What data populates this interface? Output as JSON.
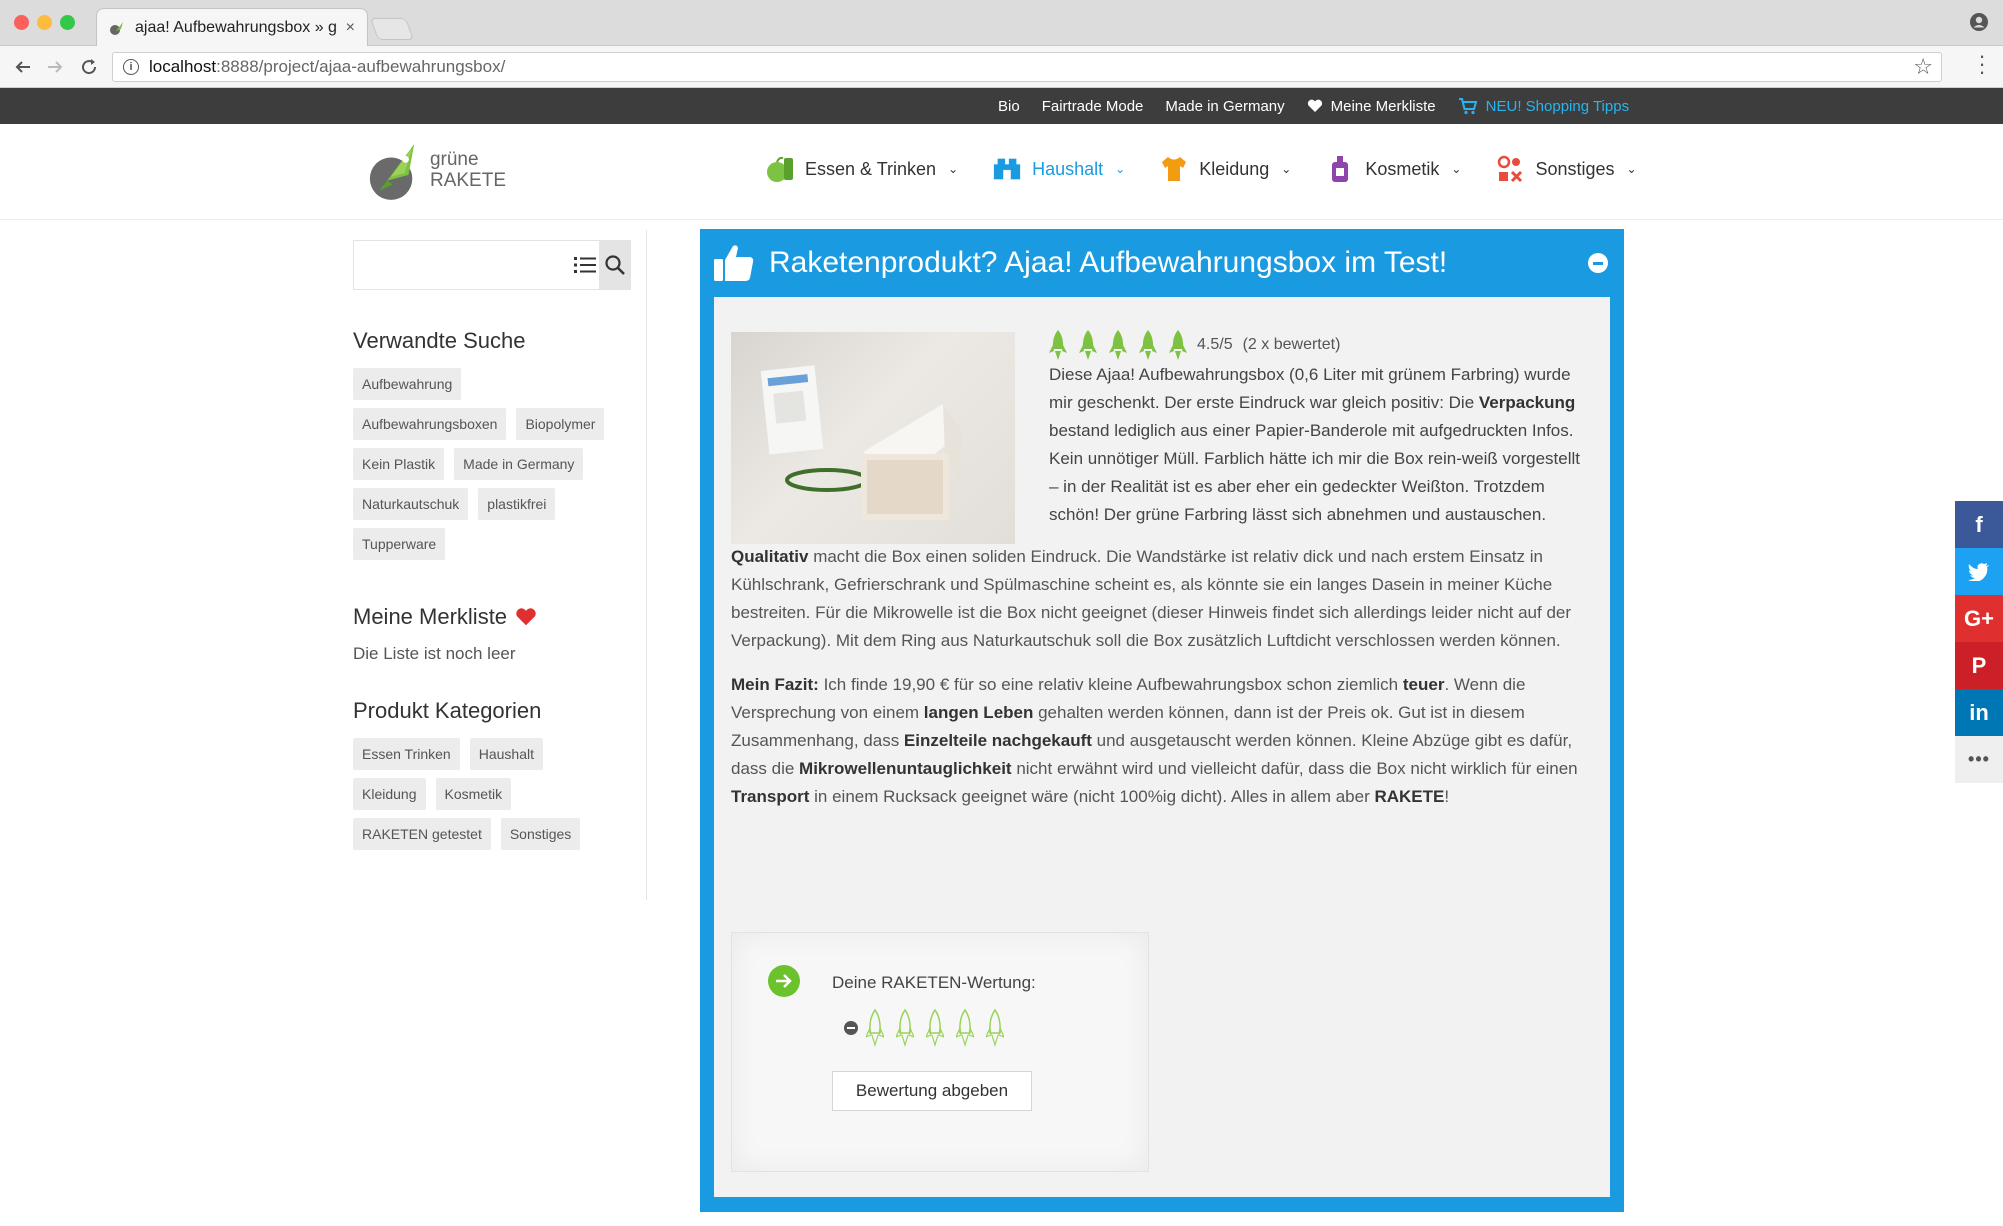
{
  "browser": {
    "tab_title": "ajaa! Aufbewahrungsbox » grü",
    "tab_close": "×",
    "url_host": "localhost",
    "url_rest": ":8888/project/ajaa-aufbewahrungsbox/"
  },
  "topbar": {
    "links": [
      "Bio",
      "Fairtrade Mode",
      "Made in Germany"
    ],
    "wishlist": "Meine Merkliste",
    "shopping": "NEU! Shopping Tipps",
    "accent_color": "#28b4f0"
  },
  "logo": {
    "line1": "grüne",
    "line2": "RAKETE"
  },
  "nav": {
    "items": [
      {
        "label": "Essen & Trinken",
        "icon": "apple-icon"
      },
      {
        "label": "Haushalt",
        "icon": "house-icon"
      },
      {
        "label": "Kleidung",
        "icon": "shirt-icon"
      },
      {
        "label": "Kosmetik",
        "icon": "bottle-icon"
      },
      {
        "label": "Sonstiges",
        "icon": "shapes-icon"
      }
    ],
    "caret": "⌄",
    "active_color": "#1a9ae0"
  },
  "sidebar": {
    "related_heading": "Verwandte Suche",
    "related_tags": [
      "Aufbewahrung",
      "Aufbewahrungsboxen",
      "Biopolymer",
      "Kein Plastik",
      "Made in Germany",
      "Naturkautschuk",
      "plastikfrei",
      "Tupperware"
    ],
    "wishlist_heading": "Meine Merkliste",
    "wishlist_empty": "Die Liste ist noch leer",
    "categories_heading": "Produkt Kategorien",
    "category_tags": [
      "Essen Trinken",
      "Haushalt",
      "Kleidung",
      "Kosmetik",
      "RAKETEN getestet",
      "Sonstiges"
    ]
  },
  "article": {
    "title": "Raketenprodukt? Ajaa! Aufbewahrungsbox im Test!",
    "rating": "4.5/5",
    "rating_count": "(2 x bewertet)",
    "intro_a": " Diese Ajaa! Aufbewahrungsbox (0,6 Liter mit grünem Farbring) wurde mir geschenkt. Der erste Eindruck war gleich positiv: Die ",
    "intro_b": "Verpackung",
    "intro_c": " bestand lediglich aus einer Papier-Banderole mit aufgedruckten Infos. Kein unnötiger Müll. Farblich hätte ich mir die Box rein-weiß vorgestellt – in der Realität ist es aber eher ein gedeckter Weißton. Trotzdem schön! Der grüne Farbring lässt sich abnehmen und austauschen.",
    "p2_a": "Qualitativ",
    "p2_b": " macht die Box einen soliden Eindruck. Die Wandstärke ist relativ dick und nach erstem Einsatz in Kühlschrank, Gefrierschrank und Spülmaschine scheint es, als könnte sie ein langes Dasein in meiner Küche bestreiten.  Für die Mikrowelle ist die Box nicht geeignet (dieser Hinweis findet sich allerdings leider nicht auf der Verpackung). Mit dem Ring aus Naturkautschuk soll die Box zusätzlich Luftdicht verschlossen werden können.",
    "p3_a": "Mein Fazit:",
    "p3_b": " Ich finde 19,90 € für so eine relativ kleine Aufbewahrungsbox schon ziemlich ",
    "p3_c": "teuer",
    "p3_d": ". Wenn die Versprechung von einem ",
    "p3_e": "langen Leben",
    "p3_f": " gehalten werden können, dann ist der Preis ok. Gut ist in diesem Zusammenhang, dass ",
    "p3_g": "Einzelteile nachgekauft",
    "p3_h": " und ausgetauscht werden können. Kleine Abzüge gibt es dafür, dass die ",
    "p3_i": "Mikrowellenuntauglichkeit",
    "p3_j": " nicht erwähnt wird und vielleicht dafür, dass die Box nicht wirklich für einen ",
    "p3_k": "Transport",
    "p3_l": " in einem Rucksack geeignet wäre (nicht 100%ig dicht). Alles in allem aber ",
    "p3_m": "RAKETE",
    "p3_n": "!"
  },
  "vote": {
    "label": "Deine RAKETEN-Wertung:",
    "button": "Bewertung abgeben"
  },
  "share": {
    "facebook": "f",
    "twitter": "t",
    "googleplus": "G+",
    "pinterest": "P",
    "linkedin": "in",
    "more": "•••",
    "colors": [
      "#3b5998",
      "#1da1f2",
      "#e02f2f",
      "#cb2027",
      "#0077b5"
    ]
  }
}
